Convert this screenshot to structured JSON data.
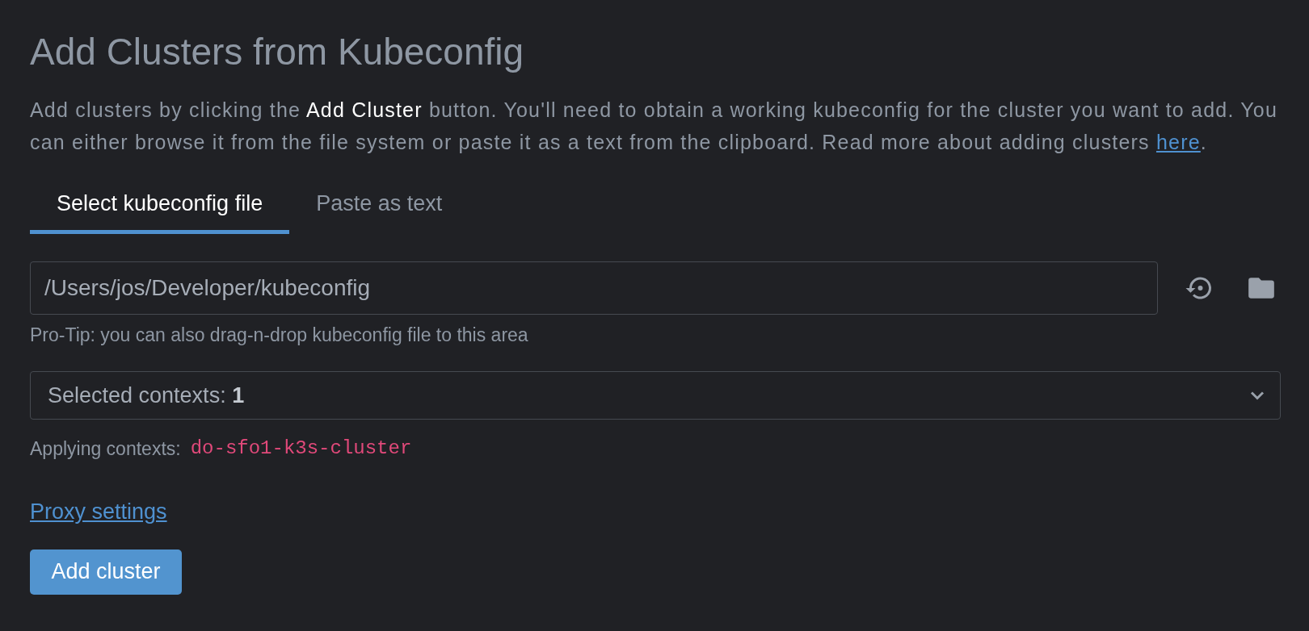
{
  "title": "Add Clusters from Kubeconfig",
  "description": {
    "text": "Add clusters by clicking the **Add Cluster** button. You'll need to obtain a working kubeconfig for the cluster you want to add. You can either browse it from the file system or paste it as a text from the clipboard. Read more about adding clusters ",
    "link": "here",
    "after": "."
  },
  "tabs": [
    {
      "label": "Select kubeconfig file",
      "selected": true
    },
    {
      "label": "Paste as text",
      "selected": false
    }
  ],
  "file_field": {
    "value": "/Users/jos/Developer/kubeconfig"
  },
  "hint": "Pro-Tip: you can also drag-n-drop kubeconfig file to this area",
  "contexts_select": {
    "label": "Selected contexts: **1**"
  },
  "applying": {
    "label": "Applying contexts:",
    "contexts": [
      "do-sfo1-k3s-cluster"
    ]
  },
  "proxy_link": "Proxy settings",
  "submit_button": "Add cluster"
}
